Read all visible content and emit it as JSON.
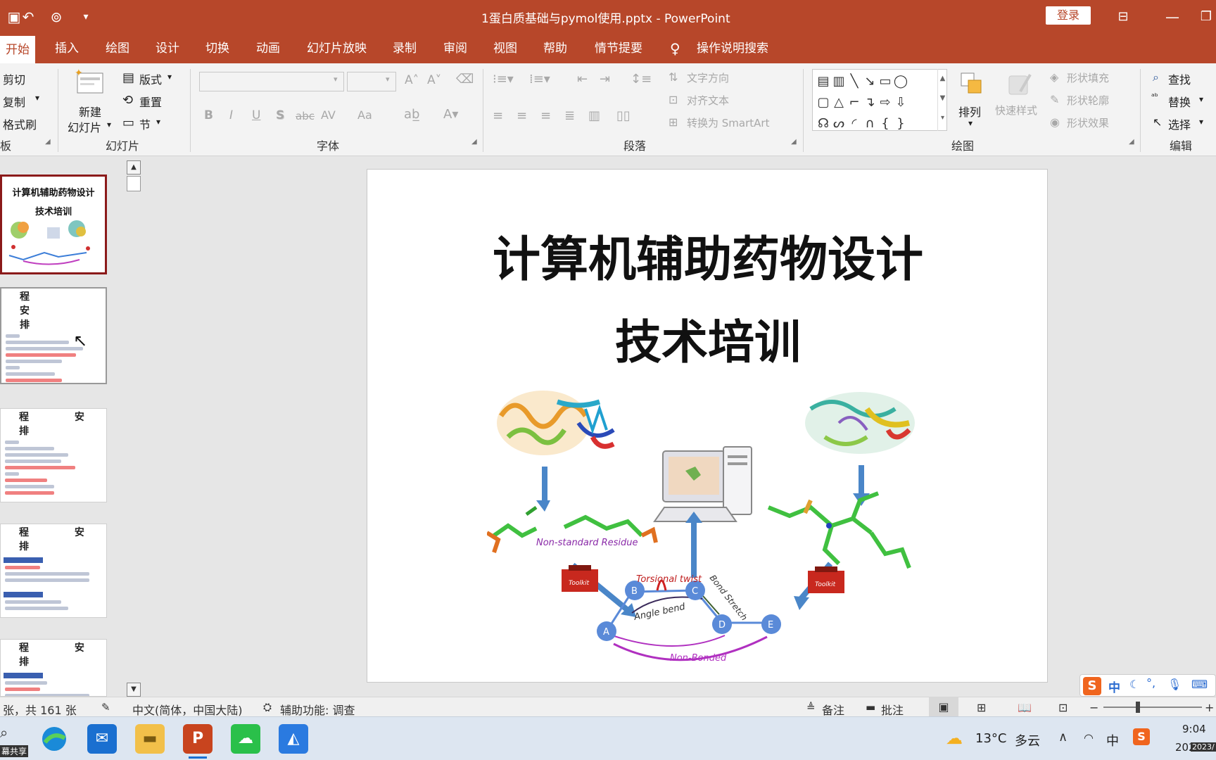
{
  "window": {
    "title": "1蛋白质基础与pymol使用.pptx  -  PowerPoint",
    "login_label": "登录"
  },
  "tabs": [
    {
      "label": "开始",
      "active": true
    },
    {
      "label": "插入"
    },
    {
      "label": "绘图"
    },
    {
      "label": "设计"
    },
    {
      "label": "切换"
    },
    {
      "label": "动画"
    },
    {
      "label": "幻灯片放映"
    },
    {
      "label": "录制"
    },
    {
      "label": "审阅"
    },
    {
      "label": "视图"
    },
    {
      "label": "帮助"
    },
    {
      "label": "情节提要"
    }
  ],
  "tell_me": "操作说明搜索",
  "ribbon": {
    "clipboard": {
      "cut": "剪切",
      "copy": "复制",
      "format_painter": "格式刷",
      "group_label": "板"
    },
    "slides": {
      "new_slide_line1": "新建",
      "new_slide_line2": "幻灯片",
      "layout": "版式",
      "reset": "重置",
      "section": "节",
      "group_label": "幻灯片"
    },
    "font": {
      "group_label": "字体",
      "bold": "B",
      "italic": "I",
      "underline": "U",
      "shadow": "S",
      "strike": "abc",
      "spacing": "AV",
      "case": "Aa"
    },
    "paragraph": {
      "text_direction": "文字方向",
      "align_text": "对齐文本",
      "convert_smartart": "转换为 SmartArt",
      "group_label": "段落"
    },
    "drawing": {
      "arrange": "排列",
      "quick_styles": "快速样式",
      "shape_fill": "形状填充",
      "shape_outline": "形状轮廓",
      "shape_effects": "形状效果",
      "group_label": "绘图"
    },
    "editing": {
      "find": "查找",
      "replace": "替换",
      "select": "选择",
      "group_label": "编辑"
    }
  },
  "slide": {
    "title_line1": "计算机辅助药物设计",
    "title_line2": "技术培训",
    "labels": {
      "non_standard": "Non-standard Residue",
      "torsional": "Torsional twist",
      "angle": "Angle bend",
      "bond": "Bond Stretch",
      "nonbonded": "Non-Bonded",
      "toolkit": "Toolkit",
      "nodes": [
        "A",
        "B",
        "C",
        "D",
        "E"
      ]
    }
  },
  "thumbnails": {
    "t1_line1": "计算机辅助药物设计",
    "t1_line2": "技术培训",
    "schedule_header": "程 安 排"
  },
  "status": {
    "slide_count": "张，共 161 张",
    "language": "中文(简体，中国大陆)",
    "accessibility": "辅助功能: 调查",
    "notes": "备注",
    "comments": "批注"
  },
  "taskbar": {
    "share": "幕共享",
    "weather_temp": "13°C",
    "weather_desc": "多云",
    "ime": "中",
    "time": "9:04",
    "date": "202",
    "year_badge": "2023/"
  },
  "ime_bar": {
    "lang": "中"
  }
}
